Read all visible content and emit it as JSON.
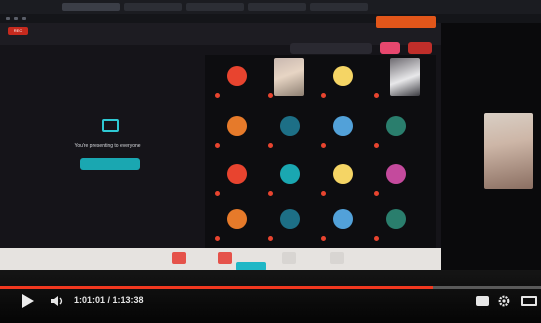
{
  "meeting": {
    "share_prompt": "You're presenting to everyone",
    "rec_label": "REC"
  },
  "player": {
    "time_display": "1:01:01 / 1:13:38",
    "progress_fraction": 0.8
  },
  "colors": {
    "accent_teal": "#1fb7c6",
    "progress_red": "#f2381f",
    "avatar_palette": [
      "#e8442f",
      "#1aa7b1",
      "#f5d565",
      "#c44a9d",
      "#e67a2a",
      "#1d6f86",
      "#52a1d9",
      "#2a7e6d"
    ]
  },
  "icons": [
    "play-icon",
    "volume-icon",
    "captions-icon",
    "settings-icon",
    "theater-mode-icon",
    "present-screen-icon",
    "record-icon"
  ]
}
